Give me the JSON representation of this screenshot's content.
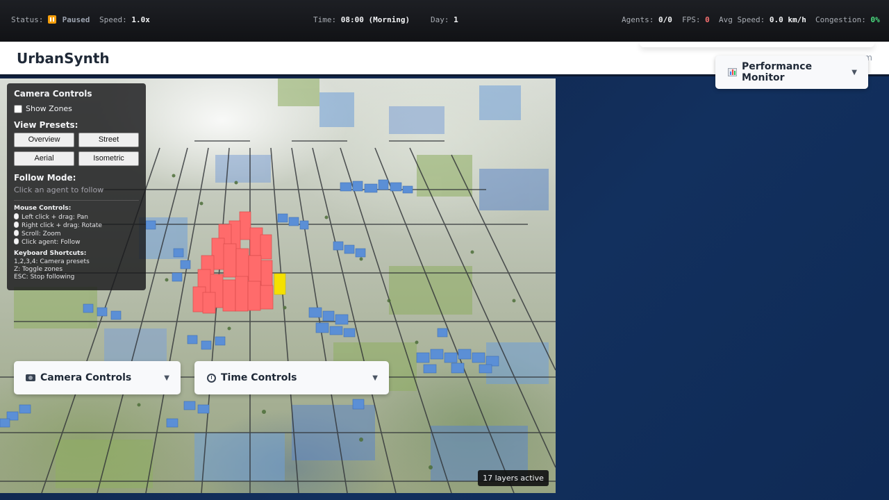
{
  "status_bar": {
    "status_label": "Status:",
    "status_value": "Paused",
    "speed_label": "Speed:",
    "speed_value": "1.0x",
    "time_label": "Time:",
    "time_value": "08:00 (Morning)",
    "day_label": "Day:",
    "day_value": "1",
    "agents_label": "Agents:",
    "agents_value": "0/0",
    "fps_label": "FPS:",
    "fps_value": "0",
    "avg_speed_label": "Avg Speed:",
    "avg_speed_value": "0.0 km/h",
    "congestion_label": "Congestion:",
    "congestion_value": "0%",
    "colors": {
      "paused": "#f59e0b",
      "fps": "#f87171",
      "congestion": "#4ade80"
    }
  },
  "header": {
    "title": "UrbanSynth",
    "hint_fragment": "m"
  },
  "camera_overlay": {
    "title": "Camera Controls",
    "show_zones_label": "Show Zones",
    "show_zones_checked": false,
    "view_presets_label": "View Presets:",
    "presets": [
      "Overview",
      "Street",
      "Aerial",
      "Isometric"
    ],
    "follow_mode_label": "Follow Mode:",
    "follow_mode_hint": "Click an agent to follow",
    "mouse_controls_title": "Mouse Controls:",
    "mouse_controls": [
      "Left click + drag: Pan",
      "Right click + drag: Rotate",
      "Scroll: Zoom",
      "Click agent: Follow"
    ],
    "keyboard_title": "Keyboard Shortcuts:",
    "keyboard_shortcuts": [
      "1,2,3,4: Camera presets",
      "Z: Toggle zones",
      "ESC: Stop following"
    ]
  },
  "panels": {
    "camera": {
      "label": "Camera Controls",
      "icon": "camera-icon"
    },
    "time": {
      "label": "Time Controls",
      "icon": "stopwatch-icon"
    },
    "performance": {
      "label": "Performance Monitor",
      "icon": "bar-chart-icon"
    }
  },
  "map": {
    "layers_badge": "17 layers active",
    "colors": {
      "residential": "#ff6b6b",
      "water_blocks": "#5b8fd6",
      "highlight": "#f5e100",
      "roads": "#3a3a3a"
    }
  }
}
